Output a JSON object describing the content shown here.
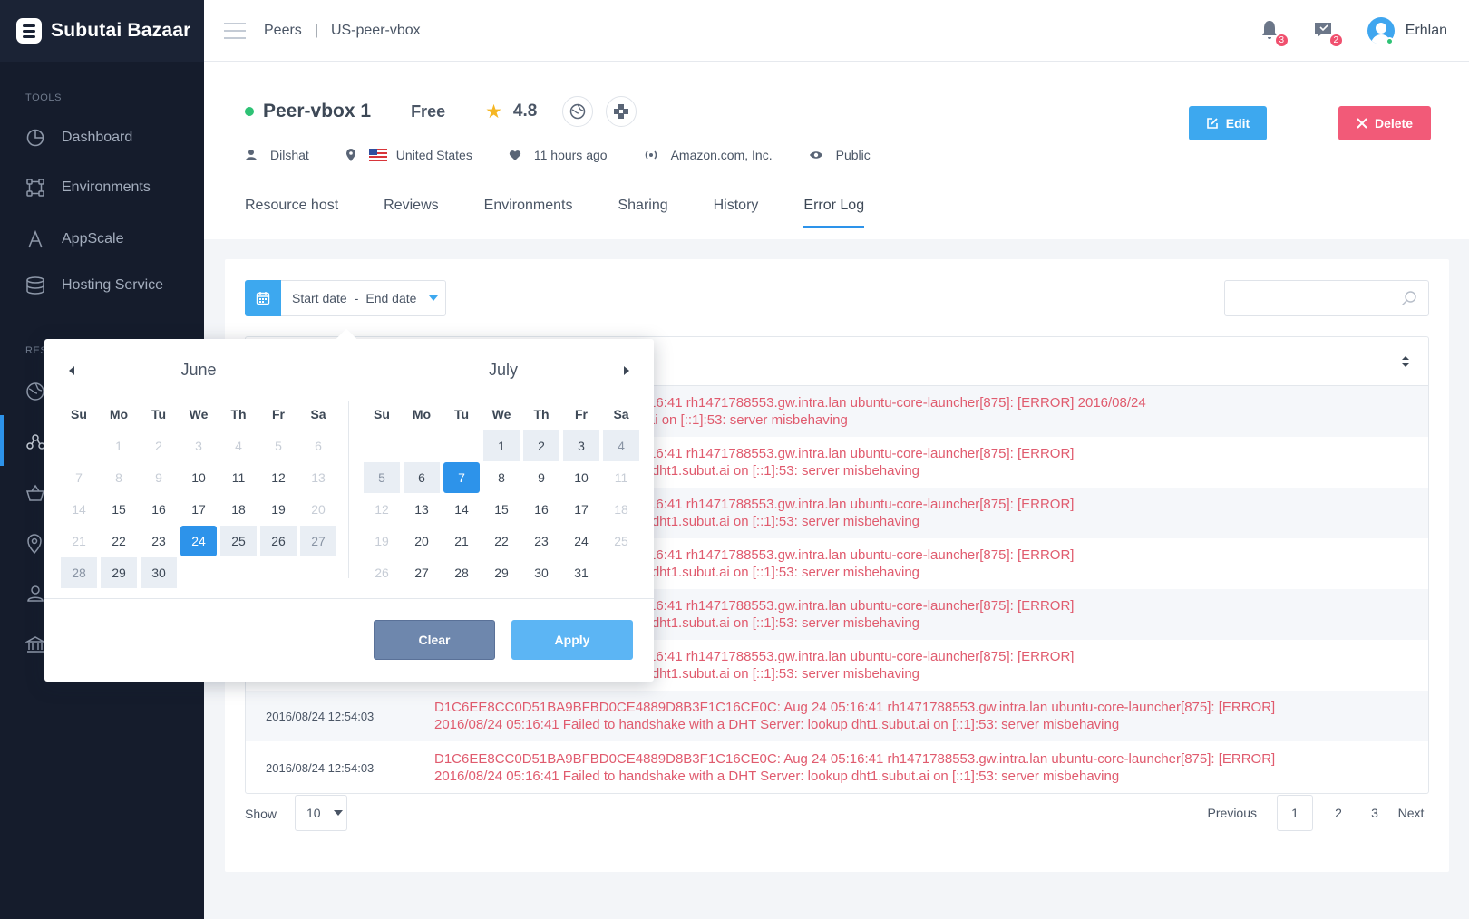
{
  "app": {
    "title": "Subutai Bazaar"
  },
  "breadcrumb": {
    "section": "Peers",
    "separator": "|",
    "current": "US-peer-vbox"
  },
  "topbar": {
    "notifications_count": "3",
    "messages_count": "2",
    "user_name": "Erhlan"
  },
  "sidebar": {
    "section_tools": "TOOLS",
    "section_res": "RES",
    "items": [
      {
        "label": "Dashboard",
        "icon": "pie-chart-icon"
      },
      {
        "label": "Environments",
        "icon": "nodes-icon"
      },
      {
        "label": "AppScale",
        "icon": "a-letter-icon"
      },
      {
        "label": "Hosting Service",
        "icon": "database-icon"
      }
    ]
  },
  "peer": {
    "name": "Peer-vbox 1",
    "price": "Free",
    "rating": "4.8",
    "owner": "Dilshat",
    "country": "United States",
    "last_seen": "11 hours ago",
    "provider": "Amazon.com, Inc.",
    "visibility": "Public"
  },
  "actions": {
    "edit": "Edit",
    "delete": "Delete"
  },
  "tabs": [
    "Resource host",
    "Reviews",
    "Environments",
    "Sharing",
    "History",
    "Error Log"
  ],
  "active_tab": "Error Log",
  "filter": {
    "start_date": "Start date",
    "sep": "-",
    "end_date": "End date"
  },
  "logs": [
    {
      "date": "",
      "msg1": "4889D8B3F1C16CE0C: Aug 24 05:16:41 rh1471788553.gw.intra.lan ubuntu-core-launcher[875]: [ERROR] 2016/08/24",
      "msg2": "n a DHT Server: lookup dht1.subut.ai on [::1]:53: server misbehaving"
    },
    {
      "date": "",
      "msg1": "4889D8B3F1C16CE0C: Aug 24 05:16:41 rh1471788553.gw.intra.lan ubuntu-core-launcher[875]: [ERROR]",
      "msg2": "ndshake with a DHT Server: lookup dht1.subut.ai on [::1]:53: server misbehaving"
    },
    {
      "date": "",
      "msg1": "4889D8B3F1C16CE0C: Aug 24 05:16:41 rh1471788553.gw.intra.lan ubuntu-core-launcher[875]: [ERROR]",
      "msg2": "ndshake with a DHT Server: lookup dht1.subut.ai on [::1]:53: server misbehaving"
    },
    {
      "date": "",
      "msg1": "4889D8B3F1C16CE0C: Aug 24 05:16:41 rh1471788553.gw.intra.lan ubuntu-core-launcher[875]: [ERROR]",
      "msg2": "ndshake with a DHT Server: lookup dht1.subut.ai on [::1]:53: server misbehaving"
    },
    {
      "date": "",
      "msg1": "4889D8B3F1C16CE0C: Aug 24 05:16:41 rh1471788553.gw.intra.lan ubuntu-core-launcher[875]: [ERROR]",
      "msg2": "ndshake with a DHT Server: lookup dht1.subut.ai on [::1]:53: server misbehaving"
    },
    {
      "date": "",
      "msg1": "4889D8B3F1C16CE0C: Aug 24 05:16:41 rh1471788553.gw.intra.lan ubuntu-core-launcher[875]: [ERROR]",
      "msg2": "ndshake with a DHT Server: lookup dht1.subut.ai on [::1]:53: server misbehaving"
    },
    {
      "date": "2016/08/24 12:54:03",
      "msg1": "D1C6EE8CC0D51BA9BFBD0CE4889D8B3F1C16CE0C: Aug 24 05:16:41 rh1471788553.gw.intra.lan ubuntu-core-launcher[875]: [ERROR]",
      "msg2": "2016/08/24 05:16:41 Failed to handshake with a DHT Server: lookup dht1.subut.ai on [::1]:53: server misbehaving"
    },
    {
      "date": "2016/08/24 12:54:03",
      "msg1": "D1C6EE8CC0D51BA9BFBD0CE4889D8B3F1C16CE0C: Aug 24 05:16:41 rh1471788553.gw.intra.lan ubuntu-core-launcher[875]: [ERROR]",
      "msg2": "2016/08/24 05:16:41 Failed to handshake with a DHT Server: lookup dht1.subut.ai on [::1]:53: server misbehaving"
    }
  ],
  "pagination": {
    "show_label": "Show",
    "page_size": "10",
    "previous": "Previous",
    "pages": [
      "1",
      "2",
      "3"
    ],
    "current": "1",
    "next": "Next"
  },
  "calendar": {
    "weekdays": [
      "Su",
      "Mo",
      "Tu",
      "We",
      "Th",
      "Fr",
      "Sa"
    ],
    "left_month": "June",
    "right_month": "July",
    "june_days": [
      "1",
      "2",
      "3",
      "4",
      "5",
      "6",
      "7",
      "8",
      "9",
      "10",
      "11",
      "12",
      "13",
      "14",
      "15",
      "16",
      "17",
      "18",
      "19",
      "20",
      "21",
      "22",
      "23",
      "24",
      "25",
      "26",
      "27",
      "28",
      "29",
      "30"
    ],
    "july_days": [
      "1",
      "2",
      "3",
      "4",
      "5",
      "6",
      "7",
      "8",
      "9",
      "10",
      "11",
      "12",
      "13",
      "14",
      "15",
      "16",
      "17",
      "18",
      "19",
      "20",
      "21",
      "22",
      "23",
      "24",
      "25",
      "26",
      "27",
      "28",
      "29",
      "30",
      "31"
    ],
    "range_start": "June 24",
    "range_end": "July 7",
    "clear": "Clear",
    "apply": "Apply"
  },
  "colors": {
    "accent": "#2d93ea",
    "danger": "#f25a78",
    "error_text": "#e05b6e",
    "sidebar": "#151c2c"
  }
}
